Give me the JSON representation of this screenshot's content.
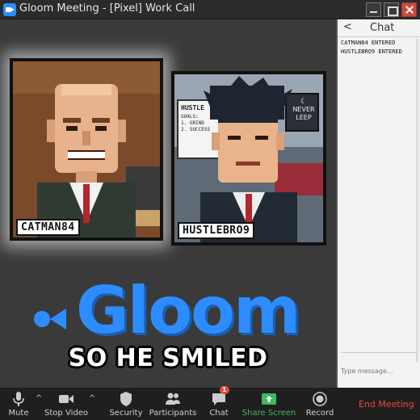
{
  "window": {
    "title": "Gloom Meeting - [Pixel] Work Call"
  },
  "participants": [
    {
      "name": "CATMAN84"
    },
    {
      "name": "HUSTLEBRO9"
    }
  ],
  "background_whiteboard": {
    "heading": "HUSTLE",
    "goals_label": "GOALS:",
    "goal_items": [
      "1. GRIND",
      "2. SUCCESS"
    ]
  },
  "poster": {
    "lines": [
      "NEVER",
      "LEEP"
    ]
  },
  "logo": {
    "text": "Gloom"
  },
  "caption": "SO HE SMILED",
  "chat": {
    "back_glyph": "<",
    "title": "Chat",
    "messages": [
      "CATMAN84 ENTERED",
      "HUSTLEBRO9 ENTERED"
    ],
    "placeholder": "Type message..."
  },
  "toolbar": {
    "mute": "Mute",
    "stop_video": "Stop Video",
    "security": "Security",
    "participants": "Participants",
    "chat": "Chat",
    "chat_badge": "1",
    "share_screen": "Share Screen",
    "record": "Record",
    "end_meeting": "End Meeting"
  },
  "colors": {
    "brand_blue": "#2d8cff",
    "end_red": "#e8483b",
    "share_green": "#3dbb5d"
  }
}
